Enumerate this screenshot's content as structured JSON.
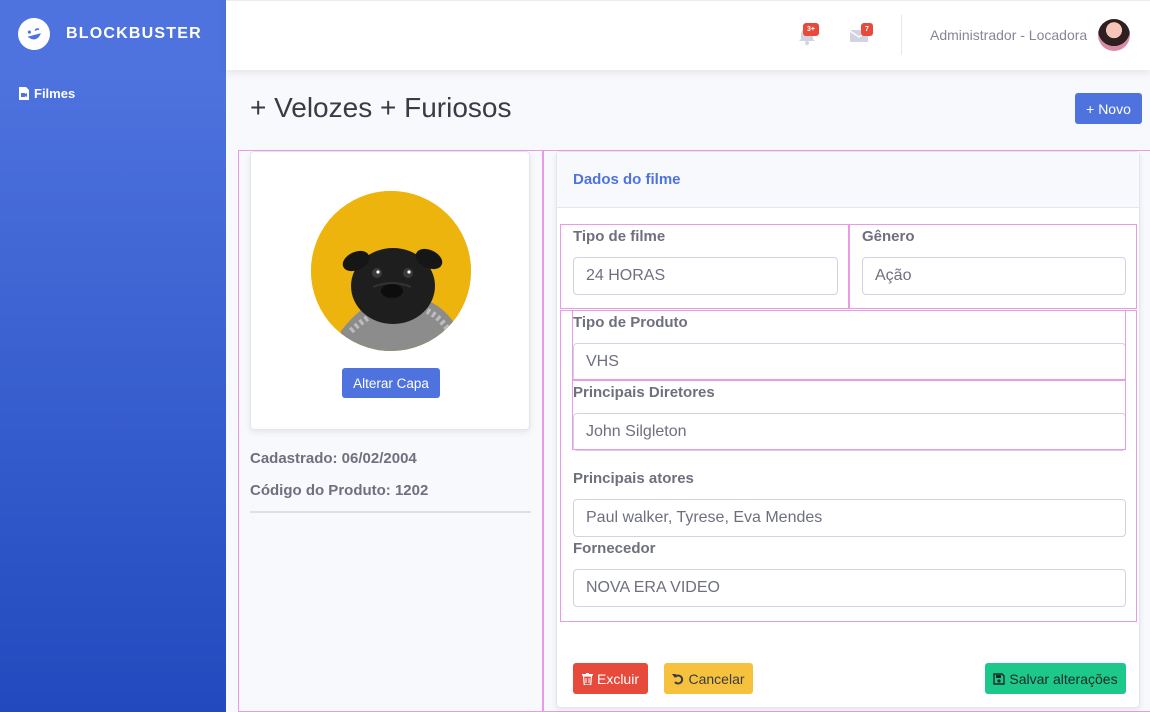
{
  "brand": {
    "name": "BLOCKBUSTER",
    "icon": "laugh-wink-icon"
  },
  "sidebar": {
    "items": [
      {
        "label": "Filmes",
        "icon": "file-video-icon"
      }
    ]
  },
  "topbar": {
    "alerts_badge": "3+",
    "messages_badge": "7",
    "user_name": "Administrador - Locadora",
    "colors": {
      "badge": "#e74a3b"
    }
  },
  "page": {
    "title": "+ Velozes + Furiosos",
    "new_button": "+ Novo"
  },
  "cover": {
    "button": "Alterar Capa"
  },
  "meta": {
    "registered": "Cadastrado: 06/02/2004",
    "product_code": "Código do Produto: 1202"
  },
  "form": {
    "header": "Dados do filme",
    "fields": {
      "tipo_filme": {
        "label": "Tipo de filme",
        "value": "24 HORAS"
      },
      "genero": {
        "label": "Gênero",
        "value": "Ação"
      },
      "tipo_produto": {
        "label": "Tipo de Produto",
        "value": "VHS"
      },
      "diretores": {
        "label": "Principais Diretores",
        "value": "John Silgleton"
      },
      "atores": {
        "label": "Principais atores",
        "value": "Paul walker, Tyrese, Eva Mendes"
      },
      "fornecedor": {
        "label": "Fornecedor",
        "value": "NOVA ERA VIDEO"
      }
    },
    "buttons": {
      "delete": "Excluir",
      "cancel": "Cancelar",
      "save": "Salvar alterações"
    }
  },
  "colors": {
    "primary": "#4e73df",
    "danger": "#e74a3b",
    "warning": "#f6c23e",
    "success": "#1cc88a"
  }
}
